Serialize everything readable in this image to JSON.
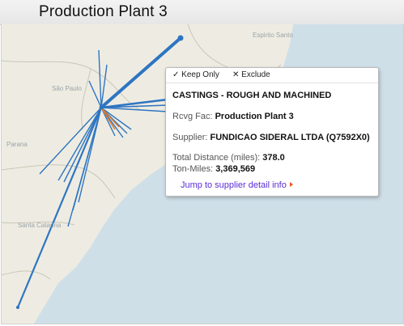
{
  "window": {
    "title": "Production Plant 3"
  },
  "map": {
    "labels": {
      "espirito_santo": "Espirito Santo",
      "sao_paulo": "São Paulo",
      "parana": "Parana",
      "santa_catarina": "Santa Catarina"
    },
    "colors": {
      "water": "#cfdfe8",
      "land": "#eeece2",
      "border": "#c9c6b8",
      "route": "#2e75c2",
      "route_highlight": "#e07b2a"
    }
  },
  "tooltip": {
    "keep_only_label": "Keep Only",
    "exclude_label": "Exclude",
    "category": "CASTINGS - ROUGH AND MACHINED",
    "rcvg_fac_label": "Rcvg Fac:",
    "rcvg_fac_value": "Production Plant 3",
    "supplier_label": "Supplier:",
    "supplier_value": "FUNDICAO SIDERAL LTDA (Q7592X0)",
    "total_distance_label": "Total Distance (miles):",
    "total_distance_value": "378.0",
    "ton_miles_label": "Ton-Miles:",
    "ton_miles_value": "3,369,569",
    "jump_link": "Jump to supplier detail info"
  }
}
